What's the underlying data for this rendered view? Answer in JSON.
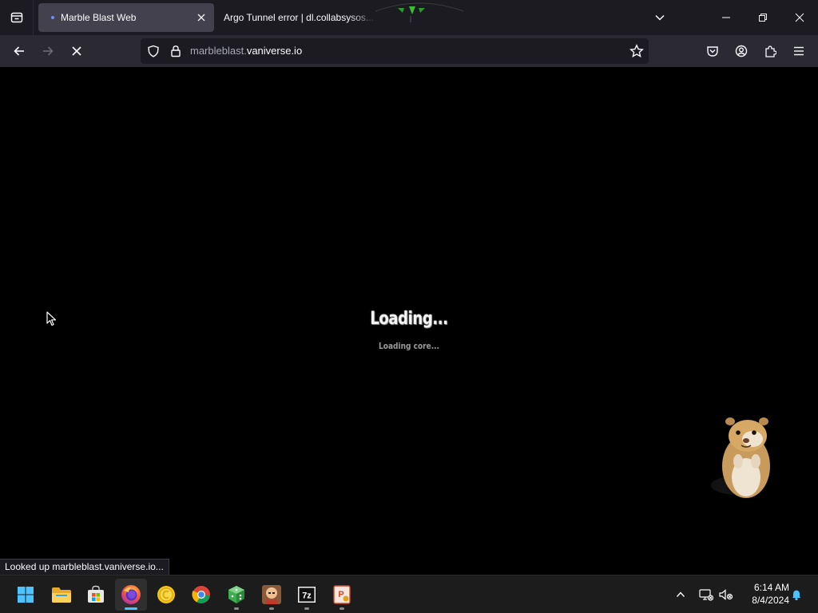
{
  "browser": {
    "tabs": [
      {
        "title": "Marble Blast Web",
        "active": true,
        "loading": true
      },
      {
        "title": "Argo Tunnel error | dl.collabsysos...",
        "active": false
      }
    ],
    "url": {
      "domain_prefix": "marbleblast.",
      "domain_main": "vaniverse.io"
    },
    "status_text": "Looked up marbleblast.vaniverse.io...",
    "icons": {
      "tab_list": "tab-list-icon",
      "tab_close": "close-icon",
      "list_all_tabs": "chevron-down-icon",
      "minimize": "minimize-icon",
      "restore": "restore-icon",
      "close_window": "close-icon",
      "back": "back-arrow-icon",
      "forward": "forward-arrow-icon",
      "stop": "stop-icon",
      "tracking_protection": "shield-icon",
      "site_security": "lock-icon",
      "bookmark": "star-icon",
      "pocket": "pocket-icon",
      "account": "account-icon",
      "extensions": "puzzle-icon",
      "menu": "hamburger-menu-icon"
    }
  },
  "page": {
    "loading_title": "Loading...",
    "loading_detail": "Loading core..."
  },
  "taskbar": {
    "apps": [
      {
        "name": "start",
        "icon": "windows-logo-icon"
      },
      {
        "name": "file-explorer",
        "icon": "folder-icon"
      },
      {
        "name": "microsoft-store",
        "icon": "store-icon"
      },
      {
        "name": "firefox",
        "icon": "firefox-icon",
        "active": true
      },
      {
        "name": "coin-app",
        "icon": "coin-icon"
      },
      {
        "name": "chrome",
        "icon": "chrome-icon"
      },
      {
        "name": "dice-app",
        "icon": "green-dice-icon"
      },
      {
        "name": "game-app",
        "icon": "character-icon"
      },
      {
        "name": "7-zip",
        "icon": "7zip-icon"
      },
      {
        "name": "powerpoint",
        "icon": "powerpoint-icon"
      }
    ],
    "tray": {
      "show_hidden": "chevron-up-icon",
      "network": "network-disconnected-icon",
      "volume": "volume-muted-icon",
      "notifications": "bell-icon"
    },
    "time": "6:14 AM",
    "date": "8/4/2024"
  },
  "colors": {
    "tab_strip": "#1c1b22",
    "toolbar": "#2b2a33",
    "active_tab": "#42414d",
    "taskbar": "#1c1c1c",
    "accent": "#4cc2ff"
  }
}
